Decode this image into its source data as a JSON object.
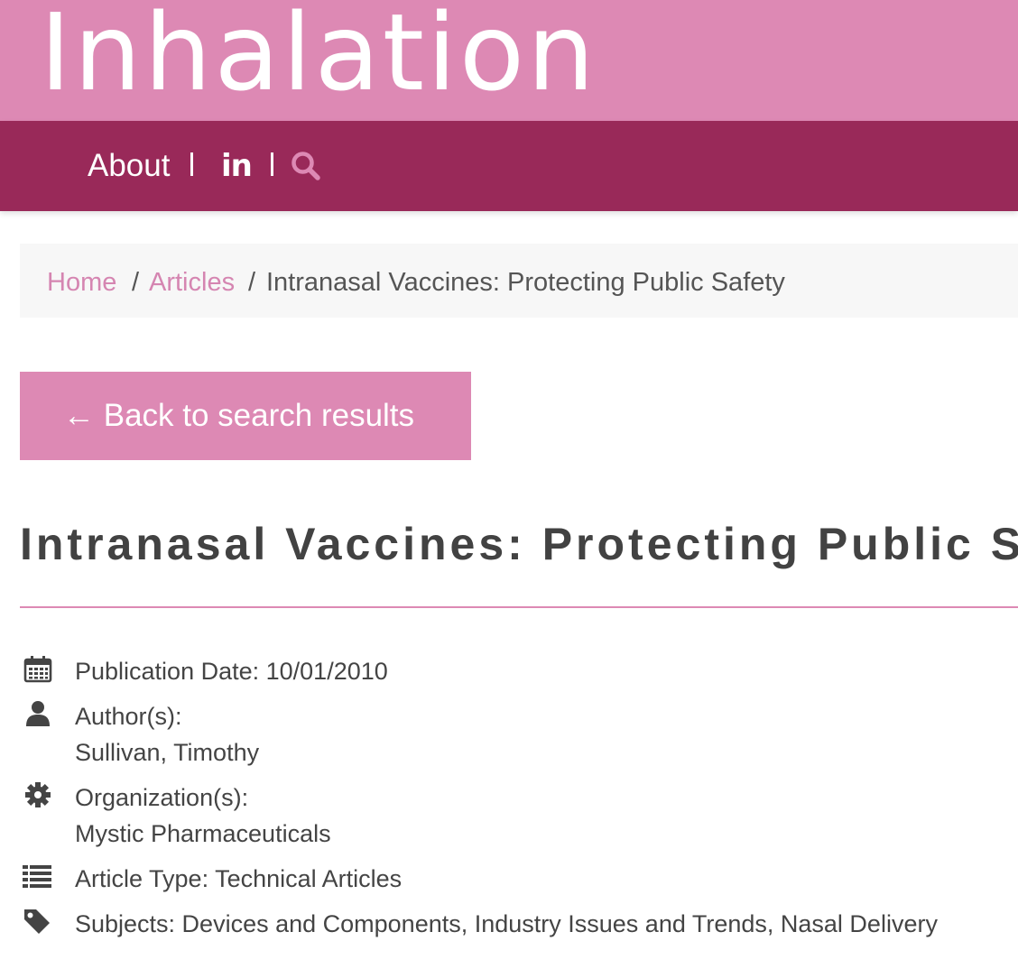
{
  "brand": {
    "title": "Inhalation"
  },
  "nav": {
    "about": "About",
    "linkedin": "in"
  },
  "breadcrumb": {
    "home": "Home",
    "articles": "Articles",
    "separator": "/",
    "current": "Intranasal Vaccines: Protecting Public Safety"
  },
  "back_button": {
    "label": "← Back to search results"
  },
  "article": {
    "title": "Intranasal Vaccines: Protecting Public Safety",
    "publication_date": "Publication Date: 10/01/2010",
    "authors_label": "Author(s):",
    "authors_value": "Sullivan, Timothy",
    "organizations_label": "Organization(s):",
    "organizations_value": "Mystic Pharmaceuticals",
    "article_type": "Article Type: Technical Articles",
    "subjects": "Subjects: Devices and Components, Industry Issues and Trends, Nasal Delivery"
  },
  "colors": {
    "brand_pink": "#dd89b4",
    "nav_plum": "#992959",
    "link_pink": "#d585b1",
    "text": "#444444"
  },
  "icons": [
    "linkedin-icon",
    "search-icon",
    "calendar-icon",
    "user-icon",
    "gear-icon",
    "list-icon",
    "tag-icon"
  ]
}
